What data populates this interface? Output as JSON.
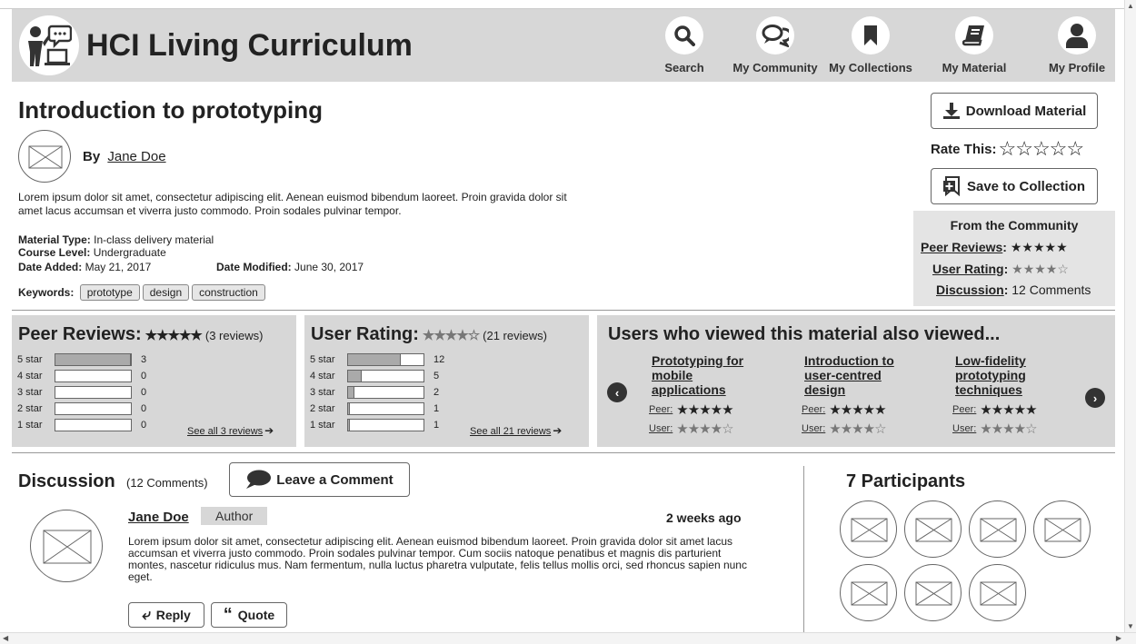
{
  "app": {
    "title": "HCI Living Curriculum"
  },
  "nav": [
    {
      "label": "Search",
      "icon": "search-icon"
    },
    {
      "label": "My Community",
      "icon": "chat-bubbles-icon"
    },
    {
      "label": "My Collections",
      "icon": "bookmark-icon"
    },
    {
      "label": "My Material",
      "icon": "book-icon"
    },
    {
      "label": "My Profile",
      "icon": "user-icon"
    }
  ],
  "material": {
    "title": "Introduction to prototyping",
    "by_label": "By",
    "author": "Jane Doe",
    "description": "Lorem ipsum dolor sit amet, consectetur adipiscing elit. Aenean euismod bibendum laoreet. Proin gravida dolor sit amet lacus accumsan et viverra justo commodo. Proin sodales pulvinar tempor.",
    "type_label": "Material Type:",
    "type": "In-class delivery material",
    "level_label": "Course Level:",
    "level": "Undergraduate",
    "added_label": "Date Added:",
    "added": "May 21, 2017",
    "modified_label": "Date Modified:",
    "modified": "June 30, 2017",
    "keywords_label": "Keywords:",
    "keywords": [
      "prototype",
      "design",
      "construction"
    ]
  },
  "actions": {
    "download": "Download Material",
    "rate_label": "Rate This:",
    "rate_stars": "☆☆☆☆☆",
    "save": "Save to Collection"
  },
  "community": {
    "title": "From the Community",
    "peer_label": "Peer Reviews",
    "peer_stars": "★★★★★",
    "user_label": "User Rating",
    "user_stars": "★★★★☆",
    "discussion_label": "Discussion",
    "discussion_value": "12 Comments"
  },
  "peer_reviews": {
    "title": "Peer Reviews:",
    "stars": "★★★★★",
    "count": "(3 reviews)",
    "rows": [
      {
        "label": "5 star",
        "count": "3",
        "fraction": 1.0
      },
      {
        "label": "4 star",
        "count": "0",
        "fraction": 0
      },
      {
        "label": "3 star",
        "count": "0",
        "fraction": 0
      },
      {
        "label": "2 star",
        "count": "0",
        "fraction": 0
      },
      {
        "label": "1 star",
        "count": "0",
        "fraction": 0
      }
    ],
    "see_all": "See all 3 reviews"
  },
  "user_rating": {
    "title": "User Rating:",
    "stars": "★★★★☆",
    "count": "(21 reviews)",
    "rows": [
      {
        "label": "5 star",
        "count": "12",
        "fraction": 0.7
      },
      {
        "label": "4 star",
        "count": "5",
        "fraction": 0.18
      },
      {
        "label": "3 star",
        "count": "2",
        "fraction": 0.08
      },
      {
        "label": "2 star",
        "count": "1",
        "fraction": 0.02
      },
      {
        "label": "1 star",
        "count": "1",
        "fraction": 0.02
      }
    ],
    "see_all": "See all 21 reviews"
  },
  "also_viewed": {
    "title": "Users who viewed this material also viewed...",
    "items": [
      {
        "name_lines": [
          "Prototyping for",
          "mobile",
          "applications"
        ],
        "peer_label": "Peer:",
        "peer_stars": "★★★★★",
        "user_label": "User:",
        "user_stars": "★★★★☆"
      },
      {
        "name_lines": [
          "Introduction to",
          "user-centred",
          "design"
        ],
        "peer_label": "Peer:",
        "peer_stars": "★★★★★",
        "user_label": "User:",
        "user_stars": "★★★★☆"
      },
      {
        "name_lines": [
          "Low-fidelity",
          "prototyping",
          "techniques"
        ],
        "peer_label": "Peer:",
        "peer_stars": "★★★★★",
        "user_label": "User:",
        "user_stars": "★★★★☆"
      }
    ]
  },
  "discussion": {
    "title": "Discussion",
    "count": "(12 Comments)",
    "leave_comment": "Leave a Comment",
    "comment": {
      "author": "Jane Doe",
      "badge": "Author",
      "time": "2 weeks ago",
      "body": "Lorem ipsum dolor sit amet, consectetur adipiscing elit. Aenean euismod bibendum laoreet. Proin gravida dolor sit amet lacus accumsan et viverra justo commodo. Proin sodales pulvinar tempor. Cum sociis natoque penatibus et magnis dis parturient montes, nascetur ridiculus mus. Nam fermentum, nulla luctus pharetra vulputate, felis tellus mollis orci, sed rhoncus sapien nunc eget.",
      "reply": "Reply",
      "quote": "Quote"
    }
  },
  "participants": {
    "title": "7 Participants",
    "count": 7
  }
}
